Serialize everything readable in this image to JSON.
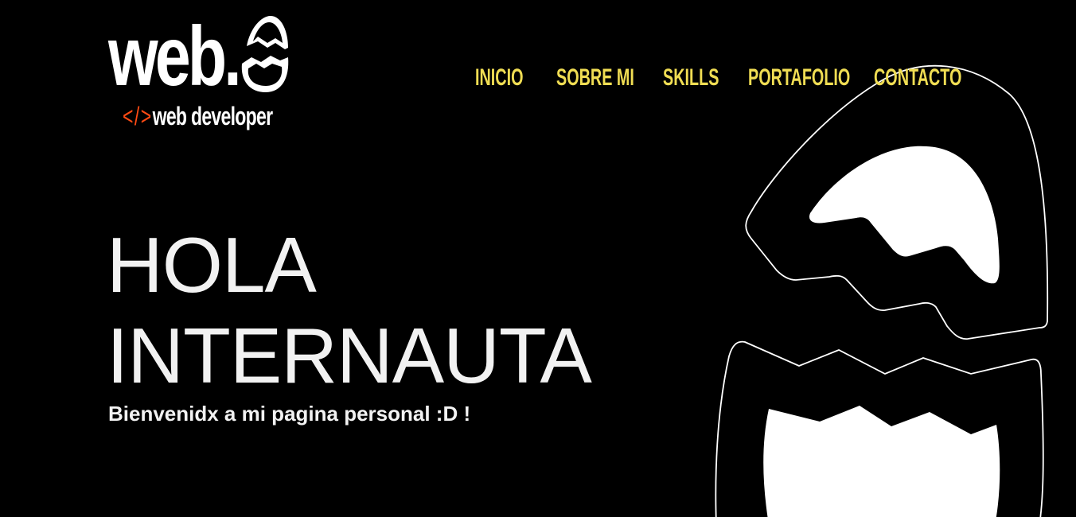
{
  "logo": {
    "word": "web.",
    "code_symbol": "</>",
    "tagline": "web developer",
    "icon": "cracked-egg-icon"
  },
  "nav": {
    "items": [
      {
        "label": "INICIO"
      },
      {
        "label": "SOBRE MI"
      },
      {
        "label": "SKILLS"
      },
      {
        "label": "PORTAFOLIO"
      },
      {
        "label": "CONTACTO"
      }
    ]
  },
  "hero": {
    "title_line1": "HOLA",
    "title_line2": "INTERNAUTA",
    "subtitle": "Bienvenidx a mi pagina personal :D !",
    "illustration": "cracked-egg-illustration"
  },
  "colors": {
    "background": "#000000",
    "nav_text": "#f0dd53",
    "code_symbol": "#ff4a13",
    "hero_text": "#f2f2f2"
  }
}
